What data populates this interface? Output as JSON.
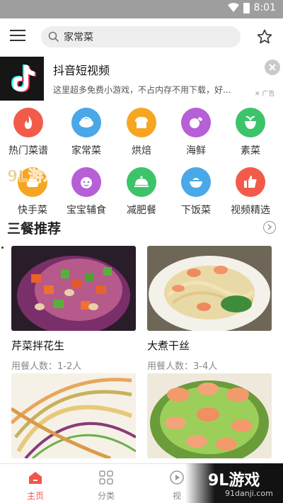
{
  "status_bar": {
    "time": "8:01"
  },
  "search": {
    "value": "家常菜"
  },
  "ad": {
    "title": "抖音短视频",
    "description": "这里超多免费小游戏，不占内存不用下载，好...",
    "tag": "广告"
  },
  "categories": [
    {
      "label": "热门菜谱",
      "icon": "flame-icon",
      "color": "#f25b4a"
    },
    {
      "label": "家常菜",
      "icon": "dish-icon",
      "color": "#4aa8e8"
    },
    {
      "label": "烘焙",
      "icon": "bread-icon",
      "color": "#f6a623"
    },
    {
      "label": "海鲜",
      "icon": "seafood-icon",
      "color": "#b65fd6"
    },
    {
      "label": "素菜",
      "icon": "vegetable-icon",
      "color": "#3dc46a"
    },
    {
      "label": "快手菜",
      "icon": "quick-meal-icon",
      "color": "#f6a623"
    },
    {
      "label": "宝宝辅食",
      "icon": "baby-icon",
      "color": "#b65fd6"
    },
    {
      "label": "减肥餐",
      "icon": "serving-dish-icon",
      "color": "#3dc46a"
    },
    {
      "label": "下饭菜",
      "icon": "rice-bowl-icon",
      "color": "#4aa8e8"
    },
    {
      "label": "视频精选",
      "icon": "thumbs-up-icon",
      "color": "#f25b4a"
    }
  ],
  "watermark": {
    "text": "91游戏",
    "url": "91danji.com"
  },
  "section": {
    "title": "三餐推荐"
  },
  "recipes": [
    {
      "name": "芹菜拌花生",
      "people": "用餐人数：1-2人"
    },
    {
      "name": "大煮干丝",
      "people": "用餐人数：3-4人"
    },
    {
      "name": "",
      "people": ""
    },
    {
      "name": "",
      "people": ""
    }
  ],
  "tabs": [
    {
      "label": "主页",
      "icon": "home-icon",
      "active": true
    },
    {
      "label": "分类",
      "icon": "grid-icon",
      "active": false
    },
    {
      "label": "视",
      "icon": "play-icon",
      "active": false
    }
  ],
  "brand": {
    "main": "9L游戏",
    "url": "91danji.com"
  },
  "colors": {
    "accent": "#f2554a",
    "statusbar": "#9e9e9e"
  }
}
